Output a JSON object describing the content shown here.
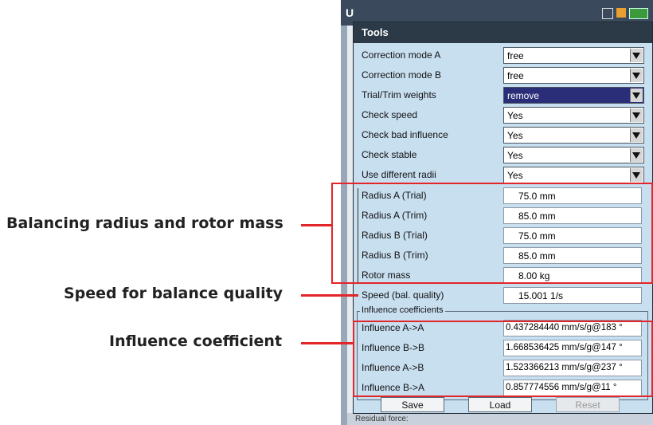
{
  "annotations": {
    "balancing": "Balancing radius and rotor mass",
    "speed": "Speed for balance quality",
    "influence": "Influence coefficient"
  },
  "device": {
    "header_letter": "U"
  },
  "dialog": {
    "title": "Tools"
  },
  "settings": [
    {
      "label": "Correction mode A",
      "value": "free"
    },
    {
      "label": "Correction mode B",
      "value": "free"
    },
    {
      "label": "Trial/Trim weights",
      "value": "remove"
    },
    {
      "label": "Check speed",
      "value": "Yes"
    },
    {
      "label": "Check bad influence",
      "value": "Yes"
    },
    {
      "label": "Check stable",
      "value": "Yes"
    },
    {
      "label": "Use different radii",
      "value": "Yes"
    }
  ],
  "radii": [
    {
      "label": "Radius A (Trial)",
      "value": "75.0 mm"
    },
    {
      "label": "Radius A (Trim)",
      "value": "85.0 mm"
    },
    {
      "label": "Radius B (Trial)",
      "value": "75.0 mm"
    },
    {
      "label": "Radius B (Trim)",
      "value": "85.0 mm"
    },
    {
      "label": "Rotor mass",
      "value": "8.00 kg"
    }
  ],
  "speed": {
    "label": "Speed (bal. quality)",
    "value": "15.001 1/s"
  },
  "influence": {
    "group_title": "Influence coefficients",
    "rows": [
      {
        "label": "Influence A->A",
        "value": "0.437284440 mm/s/g@183 °"
      },
      {
        "label": "Influence B->B",
        "value": "1.668536425 mm/s/g@147 °"
      },
      {
        "label": "Influence A->B",
        "value": "1.523366213 mm/s/g@237 °"
      },
      {
        "label": "Influence B->A",
        "value": "0.857774556 mm/s/g@11 °"
      }
    ]
  },
  "buttons": {
    "save": "Save",
    "load": "Load",
    "reset": "Reset"
  },
  "residual_text": "Residual force:",
  "colors": {
    "highlight": "#2a2e78",
    "annotation_red": "#e2262a",
    "title_bar": "#2c3a48"
  }
}
